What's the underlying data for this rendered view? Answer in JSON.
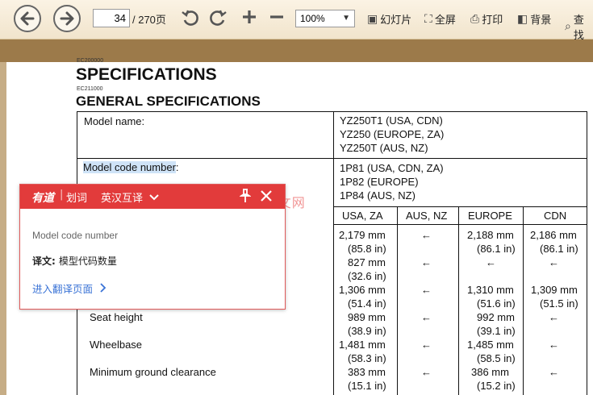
{
  "toolbar": {
    "back_icon": "arrow-left-icon",
    "forward_icon": "arrow-right-icon",
    "page_current": "34",
    "page_total": "/ 270页",
    "zoom": "100%",
    "slideshow_label": "幻灯片",
    "fullscreen_label": "全屏",
    "print_label": "打印",
    "background_label": "背景",
    "search_label": "查找"
  },
  "document": {
    "code_top": "EC200000",
    "title": "SPECIFICATIONS",
    "code_sub": "EC211000",
    "subtitle": "GENERAL SPECIFICATIONS",
    "model_name_label": "Model name:",
    "model_names": [
      "YZ250T1 (USA, CDN)",
      "YZ250 (EUROPE, ZA)",
      "YZ250T (AUS, NZ)"
    ],
    "model_code_label": "Model code number",
    "model_code_colon": ":",
    "model_codes": [
      "1P81 (USA, CDN, ZA)",
      "1P82 (EUROPE)",
      "1P84 (AUS, NZ)"
    ],
    "col_headers": [
      "USA, ZA",
      "AUS, NZ",
      "EUROPE",
      "CDN"
    ],
    "rows": [
      {
        "label": "",
        "cells": [
          [
            "2,179 mm",
            "(85.8 in)"
          ],
          [
            "←"
          ],
          [
            "2,188 mm",
            "(86.1 in)"
          ],
          [
            "2,186 mm",
            "(86.1 in)"
          ]
        ]
      },
      {
        "label": "",
        "cells": [
          [
            "827 mm",
            "(32.6 in)"
          ],
          [
            "←"
          ],
          [
            "←"
          ],
          [
            "←"
          ]
        ]
      },
      {
        "label": "",
        "cells": [
          [
            "1,306 mm",
            "(51.4 in)"
          ],
          [
            "←"
          ],
          [
            "1,310 mm",
            "(51.6 in)"
          ],
          [
            "1,309 mm",
            "(51.5 in)"
          ]
        ]
      },
      {
        "label": "Seat height",
        "cells": [
          [
            "989 mm",
            "(38.9 in)"
          ],
          [
            "←"
          ],
          [
            "992 mm",
            "(39.1 in)"
          ],
          [
            "←"
          ]
        ]
      },
      {
        "label": "Wheelbase",
        "cells": [
          [
            "1,481 mm",
            "(58.3 in)"
          ],
          [
            "←"
          ],
          [
            "1,485 mm",
            "(58.5 in)"
          ],
          [
            "←"
          ]
        ]
      },
      {
        "label": "Minimum ground clearance",
        "cells": [
          [
            "383 mm",
            "(15.1 in)"
          ],
          [
            "←"
          ],
          [
            "386 mm",
            "(15.2 in)"
          ],
          [
            "←"
          ]
        ]
      }
    ],
    "watermark": "www.     .com  木文网"
  },
  "popup": {
    "logo": "有道",
    "mode": "划词",
    "direction": "英汉互译",
    "pin_icon": "pin-icon",
    "close_icon": "close-icon",
    "source_text": "Model code number",
    "translation_label": "译文:",
    "translation": "模型代码数量",
    "goto_link": "进入翻译页面",
    "accent_color": "#e23b3b"
  }
}
